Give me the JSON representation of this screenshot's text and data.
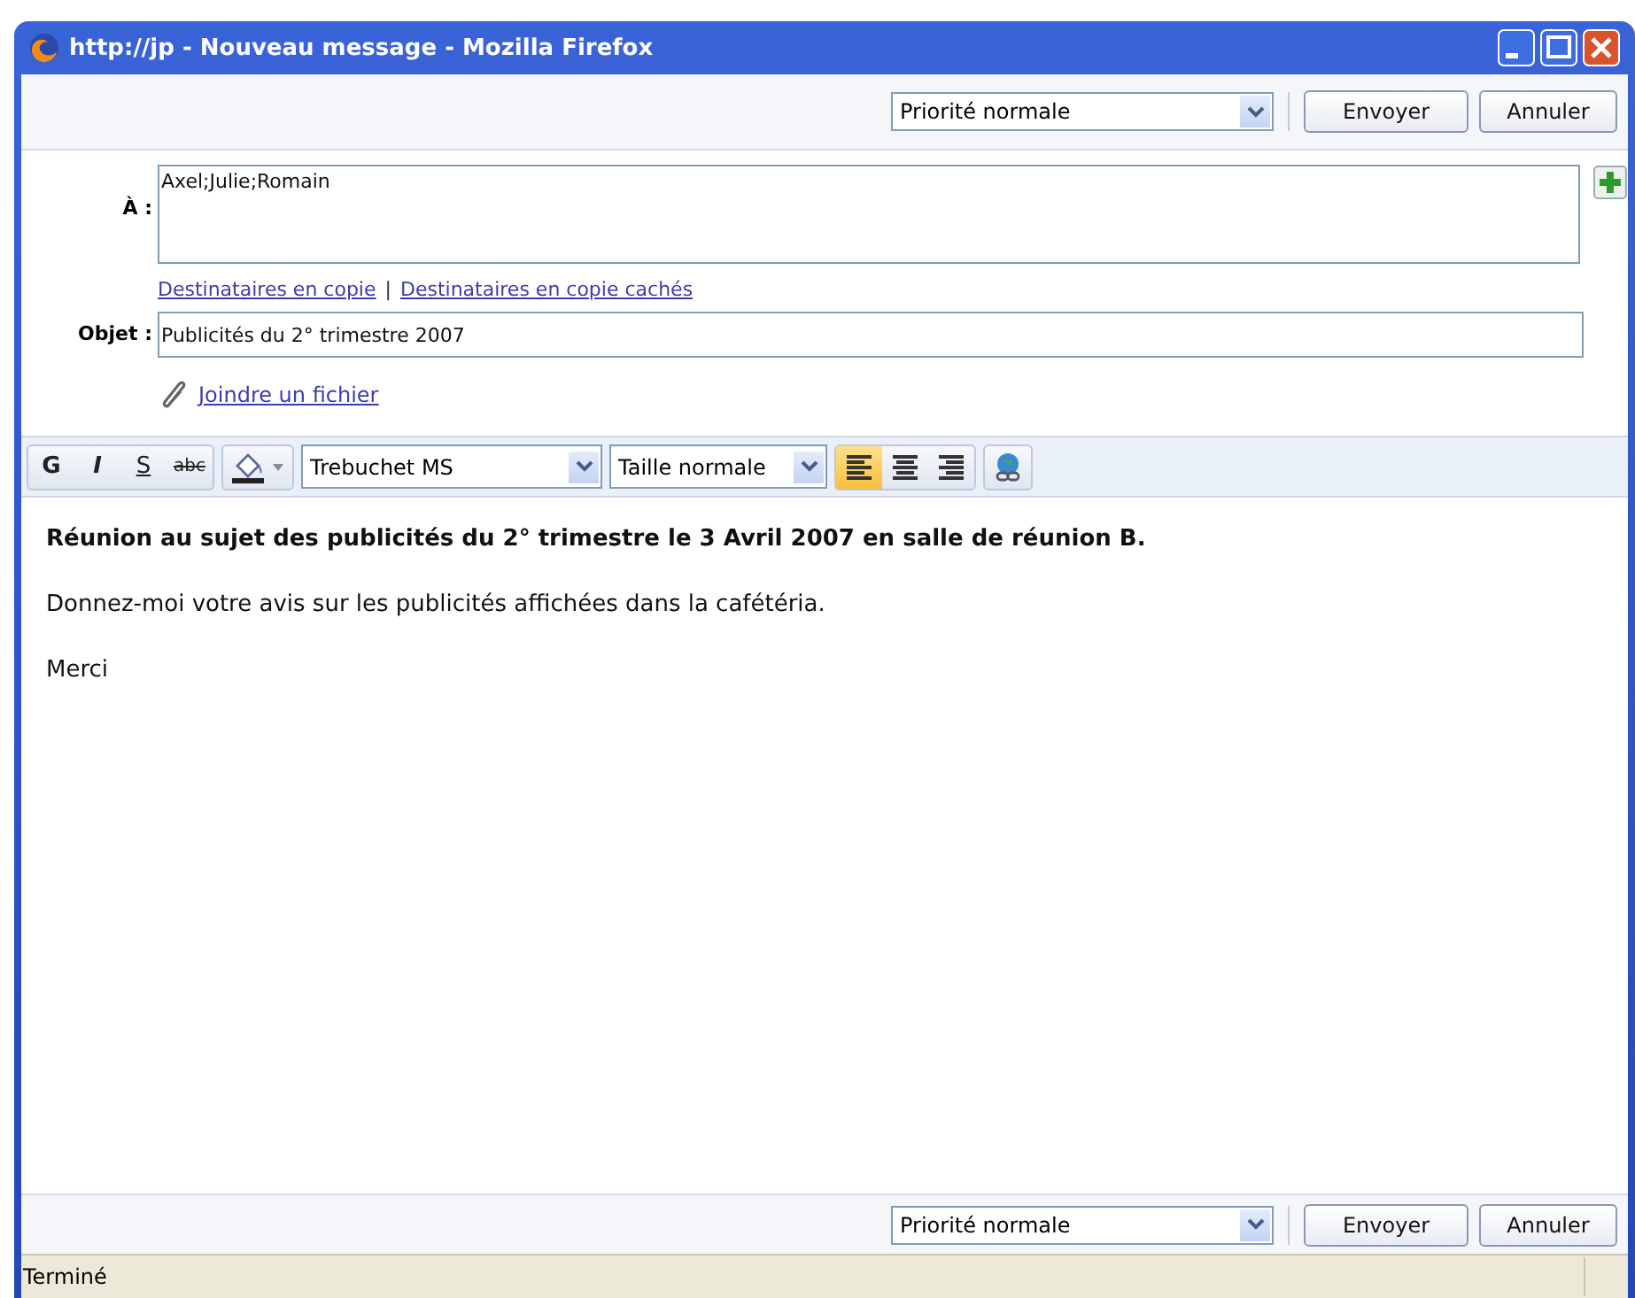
{
  "window": {
    "title": "http://jp - Nouveau message - Mozilla Firefox"
  },
  "top_toolbar": {
    "priority": "Priorité normale",
    "buttons": [
      "Envoyer",
      "Annuler"
    ]
  },
  "to": {
    "label": "À :",
    "value": "Axel;Julie;Romain"
  },
  "copy_links": [
    "Destinataires en copie",
    "|",
    "Destinataires en copie cachés"
  ],
  "subject": {
    "label": "Objet :",
    "value": "Publicités du 2° trimestre 2007"
  },
  "attach": {
    "label": "Joindre un fichier"
  },
  "format_toolbar": {
    "style_buttons": [
      {
        "label": "G",
        "kind": "bold"
      },
      {
        "label": "I",
        "kind": "italic"
      },
      {
        "label": "S",
        "kind": "underline"
      },
      {
        "label": "abc",
        "kind": "strike"
      }
    ],
    "font": "Trebuchet MS",
    "size": "Taille normale",
    "align_buttons": [
      {
        "kind": "left",
        "selected": true
      },
      {
        "kind": "center",
        "selected": false
      },
      {
        "kind": "right",
        "selected": false
      }
    ]
  },
  "body": [
    {
      "text": "Réunion au sujet des publicités du 2° trimestre le 3 Avril 2007 en salle de réunion B.",
      "bold": true
    },
    {
      "text": "Donnez-moi votre avis sur les publicités affichées dans la cafétéria.",
      "bold": false
    },
    {
      "text": "Merci",
      "bold": false
    }
  ],
  "bottom_toolbar": {
    "priority": "Priorité normale",
    "buttons": [
      "Envoyer",
      "Annuler"
    ]
  },
  "status_bar": "Terminé"
}
